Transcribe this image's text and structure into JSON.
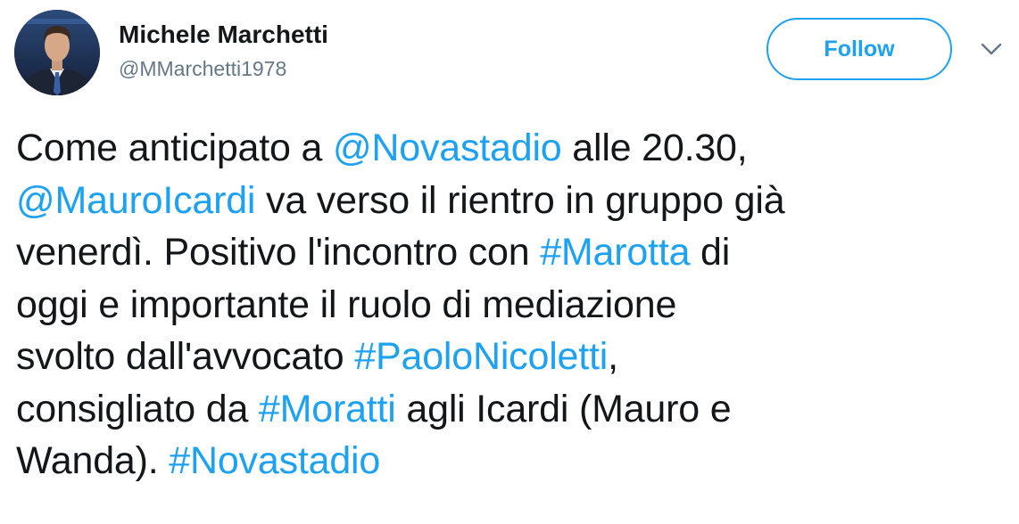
{
  "author": {
    "display_name": "Michele Marchetti",
    "handle": "@MMarchetti1978"
  },
  "follow_label": "Follow",
  "colors": {
    "link": "#1da1f2",
    "text": "#14171a",
    "handle": "#657786"
  },
  "icons": {
    "menu": "chevron-down-icon",
    "avatar": "profile-photo"
  },
  "tweet": {
    "lines": [
      [
        {
          "t": "Come anticipato a "
        },
        {
          "t": "@Novastadio",
          "link": true,
          "kind": "mention"
        },
        {
          "t": " alle 20.30,"
        }
      ],
      [
        {
          "t": "@MauroIcardi",
          "link": true,
          "kind": "mention"
        },
        {
          "t": " va verso il rientro in gruppo già"
        }
      ],
      [
        {
          "t": "venerdì. Positivo l'incontro con "
        },
        {
          "t": "#Marotta",
          "link": true,
          "kind": "hashtag"
        },
        {
          "t": " di"
        }
      ],
      [
        {
          "t": "oggi e importante il ruolo di mediazione"
        }
      ],
      [
        {
          "t": "svolto dall'avvocato "
        },
        {
          "t": "#PaoloNicoletti",
          "link": true,
          "kind": "hashtag"
        },
        {
          "t": ","
        }
      ],
      [
        {
          "t": "consigliato da "
        },
        {
          "t": "#Moratti",
          "link": true,
          "kind": "hashtag"
        },
        {
          "t": " agli Icardi (Mauro e"
        }
      ],
      [
        {
          "t": "Wanda). "
        },
        {
          "t": "#Novastadio",
          "link": true,
          "kind": "hashtag"
        }
      ]
    ]
  }
}
